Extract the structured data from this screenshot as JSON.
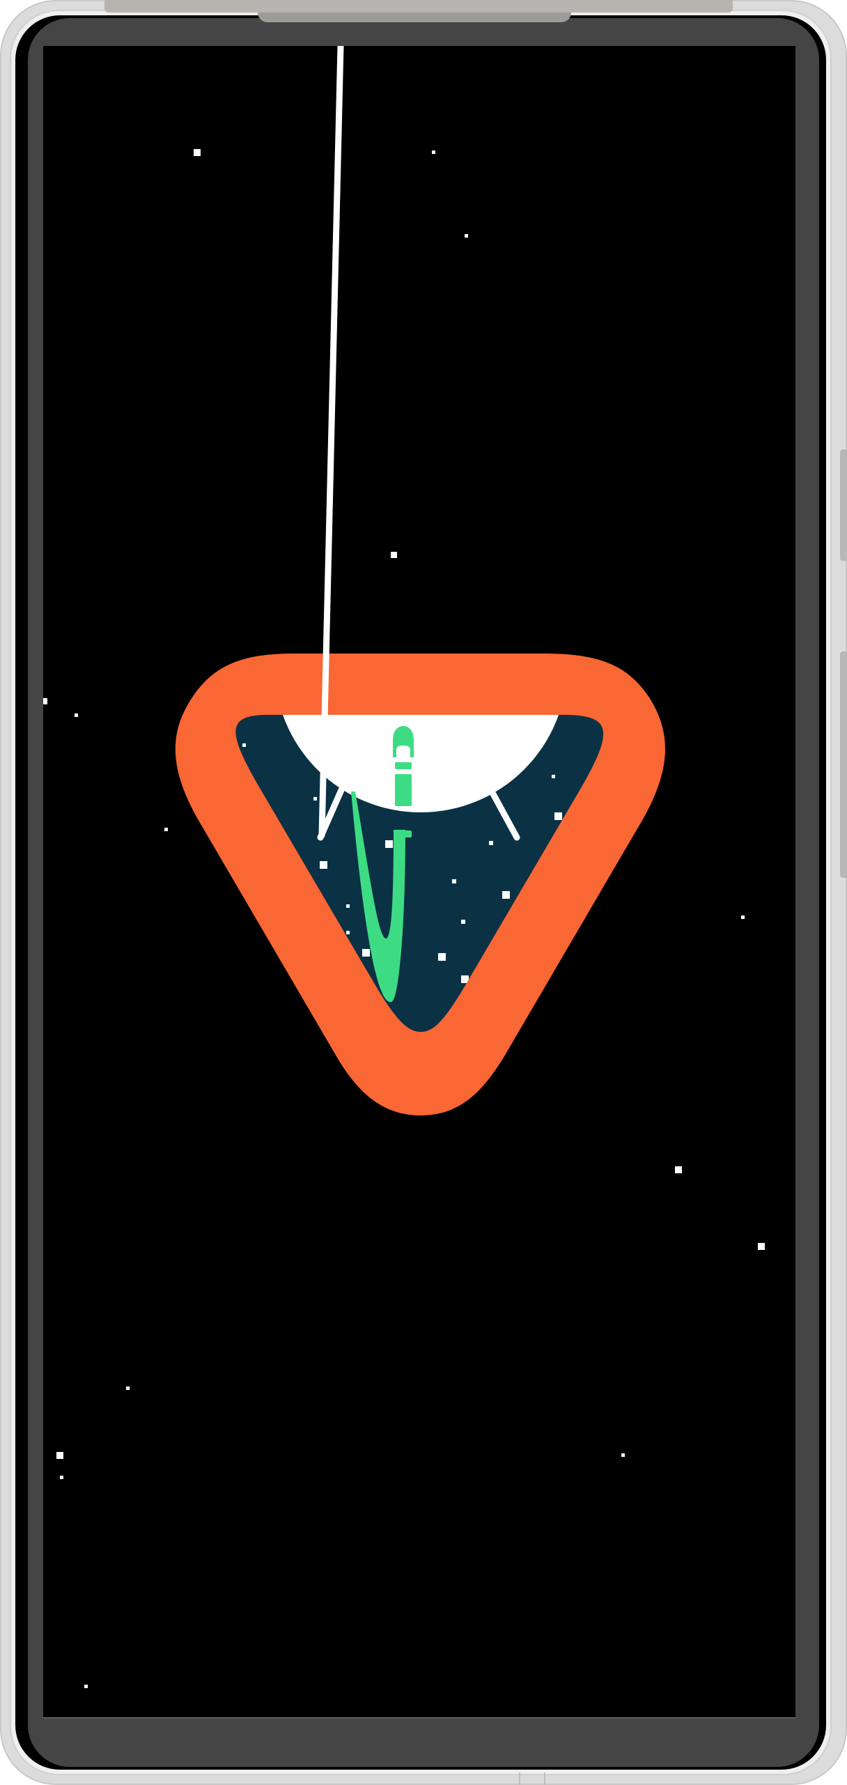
{
  "app": {
    "name": "",
    "state": "splash-screen"
  },
  "splash": {
    "logo_icon": "android-studio-rocket-icon",
    "colors": {
      "background": "#000000",
      "ring": "#F86734",
      "inner": "#0B3144",
      "planet": "#FFFFFF",
      "rocket": "#3DDC84",
      "stars": "#FFFFFF"
    }
  }
}
